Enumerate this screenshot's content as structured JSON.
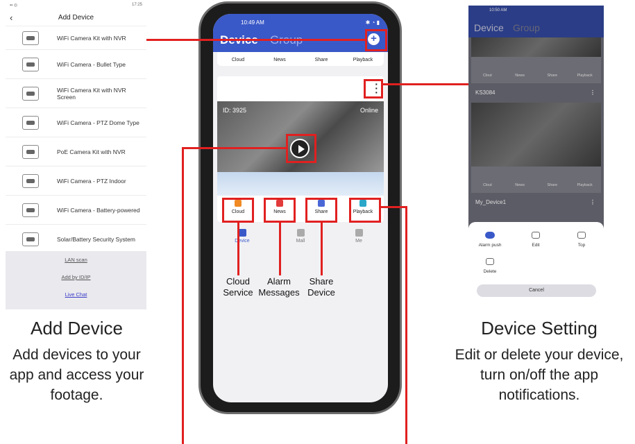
{
  "left_panel": {
    "status_time": "17:25",
    "title": "Add Device",
    "devices": [
      "WiFi Camera Kit with NVR",
      "WiFi Camera - Bullet Type",
      "WiFi Camera Kit with NVR Screen",
      "WiFi Camera - PTZ Dome Type",
      "PoE Camera Kit with NVR",
      "WiFi Camera - PTZ Indoor",
      "WiFi Camera - Battery-powered",
      "Solar/Battery Security System"
    ],
    "footer": [
      "LAN scan",
      "Add by ID/IP",
      "Live Chat"
    ]
  },
  "left_caption": {
    "title": "Add Device",
    "text": "Add devices to your app and access your footage."
  },
  "phone": {
    "status_time": "10:49 AM",
    "tab_device": "Device",
    "tab_group": "Group",
    "top_tabs": [
      "Cloud",
      "News",
      "Share",
      "Playback"
    ],
    "camera_id": "ID: 3925",
    "online": "Online",
    "actions": [
      "Cloud",
      "News",
      "Share",
      "Playback"
    ],
    "nav": [
      "Device",
      "Mall",
      "Me"
    ]
  },
  "labels": {
    "cloud": "Cloud Service",
    "alarm": "Alarm Messages",
    "share": "Share Device"
  },
  "right_panel": {
    "status_time": "10:50 AM",
    "tab_device": "Device",
    "tab_group": "Group",
    "row_tabs": [
      "Clout",
      "News",
      "Share",
      "Playback"
    ],
    "device1": "KS3084",
    "device2": "My_Device1",
    "sheet": [
      "Alarm push",
      "Edit",
      "Top",
      "Delete"
    ],
    "cancel": "Cancel"
  },
  "right_caption": {
    "title": "Device Setting",
    "text": "Edit or delete your device, turn on/off the app notifications."
  },
  "colors": {
    "accent": "#3a59c8",
    "highlight": "#e12020"
  }
}
